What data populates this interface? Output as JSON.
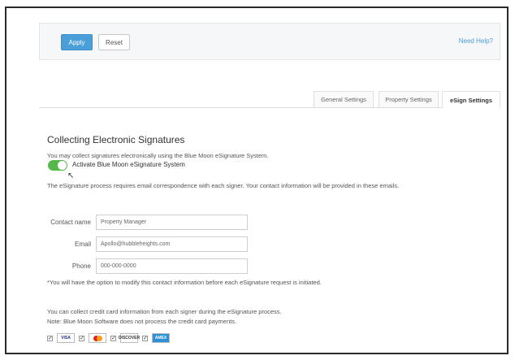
{
  "toolbar": {
    "apply_label": "Apply",
    "reset_label": "Reset",
    "help_label": "Need Help?"
  },
  "tabs": [
    {
      "label": "General Settings",
      "active": false
    },
    {
      "label": "Property Settings",
      "active": false
    },
    {
      "label": "eSign Settings",
      "active": true
    }
  ],
  "esign": {
    "title": "Collecting Electronic Signatures",
    "intro": "You may collect signatures electronically using the Blue Moon eSignature System.",
    "toggle_label": "Activate Blue Moon eSignature System",
    "toggle_on": true,
    "email_notice": "The eSignature process requires email correspondence with each signer. Your contact information will be provided in these emails."
  },
  "contact": {
    "name_label": "Contact name",
    "name_value": "Property Manager",
    "email_label": "Email",
    "email_value": "Apollo@hubbleheights.com",
    "phone_label": "Phone",
    "phone_value": "000-000-0000",
    "modify_note": "*You will have the option to modify this contact information before each eSignature request is initiated."
  },
  "payment": {
    "collect_text": "You can collect credit card information from each signer during the eSignature process.",
    "note_text": "Note: Blue Moon Software does not process the credit card payments.",
    "cards": [
      {
        "icon": "visa-card-icon",
        "label": "VISA",
        "checked": true
      },
      {
        "icon": "mastercard-card-icon",
        "label": "",
        "checked": true
      },
      {
        "icon": "discover-card-icon",
        "label": "DISCOVER",
        "checked": true
      },
      {
        "icon": "amex-card-icon",
        "label": "AMEX",
        "checked": true
      }
    ]
  },
  "colors": {
    "accent": "#4a9fd8",
    "toggle_on": "#55b84a"
  }
}
